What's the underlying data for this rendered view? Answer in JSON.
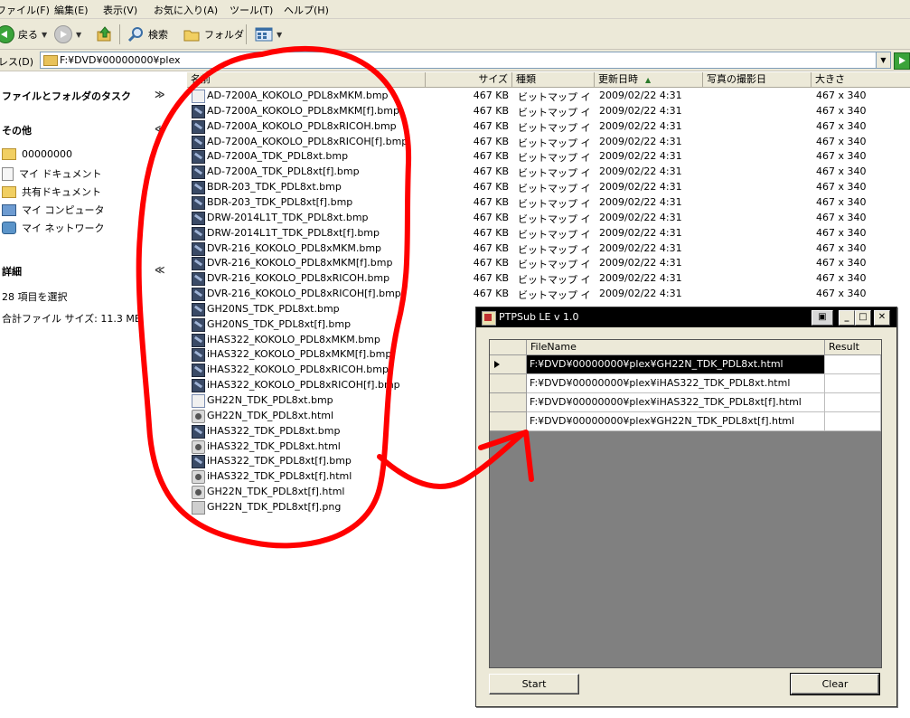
{
  "menu": [
    "ファイル(F)",
    "編集(E)",
    "表示(V)",
    "お気に入り(A)",
    "ツール(T)",
    "ヘルプ(H)"
  ],
  "toolbar": {
    "back_label": "戻る",
    "search_label": "検索",
    "folder_label": "フォルダ"
  },
  "address": {
    "label": "アドレス(D)",
    "value": "F:¥DVD¥00000000¥plex"
  },
  "taskpane": {
    "file_tasks_title": "ファイルとフォルダのタスク",
    "other_title": "その他",
    "other_items": [
      "00000000",
      "マイ ドキュメント",
      "共有ドキュメント",
      "マイ コンピュータ",
      "マイ ネットワーク"
    ],
    "details_title": "詳細",
    "selected_count": "28 項目を選択",
    "total_size": "合計ファイル サイズ: 11.3 MB"
  },
  "columns": {
    "name": "名前",
    "size": "サイズ",
    "type": "種類",
    "modified": "更新日時",
    "photo_date": "写真の撮影日",
    "dimensions": "大きさ"
  },
  "files": [
    {
      "name": "AD-7200A_KOKOLO_PDL8xMKM.bmp",
      "icon": "bmp-light",
      "size": "467 KB",
      "type": "ビットマップ イメ...",
      "date": "2009/02/22 4:31",
      "dim": "467 x 340"
    },
    {
      "name": "AD-7200A_KOKOLO_PDL8xMKM[f].bmp",
      "icon": "bmp",
      "size": "467 KB",
      "type": "ビットマップ イメ...",
      "date": "2009/02/22 4:31",
      "dim": "467 x 340"
    },
    {
      "name": "AD-7200A_KOKOLO_PDL8xRICOH.bmp",
      "icon": "bmp",
      "size": "467 KB",
      "type": "ビットマップ イメ...",
      "date": "2009/02/22 4:31",
      "dim": "467 x 340"
    },
    {
      "name": "AD-7200A_KOKOLO_PDL8xRICOH[f].bmp",
      "icon": "bmp",
      "size": "467 KB",
      "type": "ビットマップ イメ...",
      "date": "2009/02/22 4:31",
      "dim": "467 x 340"
    },
    {
      "name": "AD-7200A_TDK_PDL8xt.bmp",
      "icon": "bmp",
      "size": "467 KB",
      "type": "ビットマップ イメ...",
      "date": "2009/02/22 4:31",
      "dim": "467 x 340"
    },
    {
      "name": "AD-7200A_TDK_PDL8xt[f].bmp",
      "icon": "bmp",
      "size": "467 KB",
      "type": "ビットマップ イメ...",
      "date": "2009/02/22 4:31",
      "dim": "467 x 340"
    },
    {
      "name": "BDR-203_TDK_PDL8xt.bmp",
      "icon": "bmp",
      "size": "467 KB",
      "type": "ビットマップ イメ...",
      "date": "2009/02/22 4:31",
      "dim": "467 x 340"
    },
    {
      "name": "BDR-203_TDK_PDL8xt[f].bmp",
      "icon": "bmp",
      "size": "467 KB",
      "type": "ビットマップ イメ...",
      "date": "2009/02/22 4:31",
      "dim": "467 x 340"
    },
    {
      "name": "DRW-2014L1T_TDK_PDL8xt.bmp",
      "icon": "bmp",
      "size": "467 KB",
      "type": "ビットマップ イメ...",
      "date": "2009/02/22 4:31",
      "dim": "467 x 340"
    },
    {
      "name": "DRW-2014L1T_TDK_PDL8xt[f].bmp",
      "icon": "bmp",
      "size": "467 KB",
      "type": "ビットマップ イメ...",
      "date": "2009/02/22 4:31",
      "dim": "467 x 340"
    },
    {
      "name": "DVR-216_KOKOLO_PDL8xMKM.bmp",
      "icon": "bmp",
      "size": "467 KB",
      "type": "ビットマップ イメ...",
      "date": "2009/02/22 4:31",
      "dim": "467 x 340"
    },
    {
      "name": "DVR-216_KOKOLO_PDL8xMKM[f].bmp",
      "icon": "bmp",
      "size": "467 KB",
      "type": "ビットマップ イメ...",
      "date": "2009/02/22 4:31",
      "dim": "467 x 340"
    },
    {
      "name": "DVR-216_KOKOLO_PDL8xRICOH.bmp",
      "icon": "bmp",
      "size": "467 KB",
      "type": "ビットマップ イメ...",
      "date": "2009/02/22 4:31",
      "dim": "467 x 340"
    },
    {
      "name": "DVR-216_KOKOLO_PDL8xRICOH[f].bmp",
      "icon": "bmp",
      "size": "467 KB",
      "type": "ビットマップ イメ...",
      "date": "2009/02/22 4:31",
      "dim": "467 x 340"
    },
    {
      "name": "GH20NS_TDK_PDL8xt.bmp",
      "icon": "bmp",
      "size": "",
      "type": "",
      "date": "",
      "dim": ""
    },
    {
      "name": "GH20NS_TDK_PDL8xt[f].bmp",
      "icon": "bmp",
      "size": "",
      "type": "",
      "date": "",
      "dim": ""
    },
    {
      "name": "iHAS322_KOKOLO_PDL8xMKM.bmp",
      "icon": "bmp",
      "size": "",
      "type": "",
      "date": "",
      "dim": ""
    },
    {
      "name": "iHAS322_KOKOLO_PDL8xMKM[f].bmp",
      "icon": "bmp",
      "size": "",
      "type": "",
      "date": "",
      "dim": ""
    },
    {
      "name": "iHAS322_KOKOLO_PDL8xRICOH.bmp",
      "icon": "bmp",
      "size": "",
      "type": "",
      "date": "",
      "dim": ""
    },
    {
      "name": "iHAS322_KOKOLO_PDL8xRICOH[f].bmp",
      "icon": "bmp",
      "size": "",
      "type": "",
      "date": "",
      "dim": ""
    },
    {
      "name": "GH22N_TDK_PDL8xt.bmp",
      "icon": "bmp-light",
      "size": "",
      "type": "",
      "date": "",
      "dim": ""
    },
    {
      "name": "GH22N_TDK_PDL8xt.html",
      "icon": "html",
      "size": "",
      "type": "",
      "date": "",
      "dim": ""
    },
    {
      "name": "iHAS322_TDK_PDL8xt.bmp",
      "icon": "bmp",
      "size": "",
      "type": "",
      "date": "",
      "dim": ""
    },
    {
      "name": "iHAS322_TDK_PDL8xt.html",
      "icon": "html",
      "size": "",
      "type": "",
      "date": "",
      "dim": ""
    },
    {
      "name": "iHAS322_TDK_PDL8xt[f].bmp",
      "icon": "bmp",
      "size": "",
      "type": "",
      "date": "",
      "dim": ""
    },
    {
      "name": "iHAS322_TDK_PDL8xt[f].html",
      "icon": "html",
      "size": "",
      "type": "",
      "date": "",
      "dim": ""
    },
    {
      "name": "GH22N_TDK_PDL8xt[f].html",
      "icon": "html",
      "size": "",
      "type": "",
      "date": "",
      "dim": ""
    },
    {
      "name": "GH22N_TDK_PDL8xt[f].png",
      "icon": "png",
      "size": "",
      "type": "",
      "date": "",
      "dim": ""
    }
  ],
  "ptpsub": {
    "title": "PTPSub LE v 1.0",
    "col_filename": "FileName",
    "col_result": "Result",
    "rows": [
      {
        "file": "F:¥DVD¥00000000¥plex¥GH22N_TDK_PDL8xt.html",
        "result": "",
        "selected": true
      },
      {
        "file": "F:¥DVD¥00000000¥plex¥iHAS322_TDK_PDL8xt.html",
        "result": "",
        "selected": false
      },
      {
        "file": "F:¥DVD¥00000000¥plex¥iHAS322_TDK_PDL8xt[f].html",
        "result": "",
        "selected": false
      },
      {
        "file": "F:¥DVD¥00000000¥plex¥GH22N_TDK_PDL8xt[f].html",
        "result": "",
        "selected": false
      }
    ],
    "start_label": "Start",
    "clear_label": "Clear"
  },
  "colors": {
    "annotation": "#ff0000",
    "title_bar": "#000000",
    "grid_bg": "#808080"
  }
}
